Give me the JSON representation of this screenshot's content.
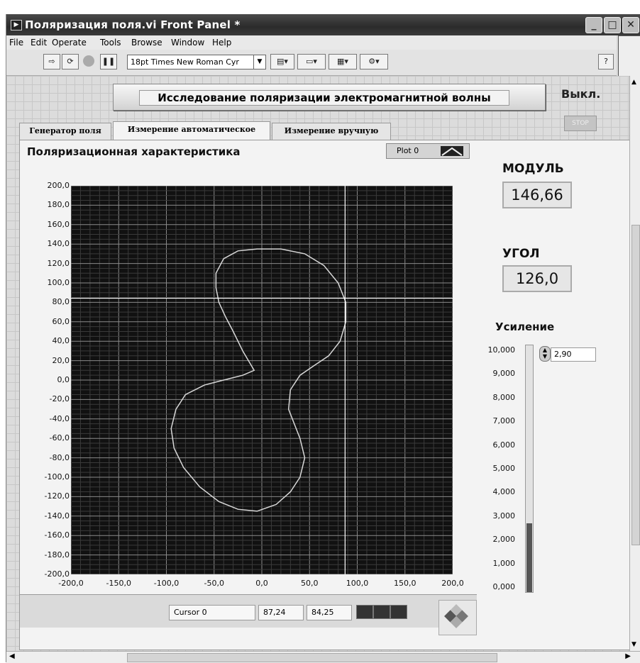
{
  "window": {
    "title": "Поляризация поля.vi Front Panel *"
  },
  "menu": [
    "File",
    "Edit",
    "Operate",
    "Tools",
    "Browse",
    "Window",
    "Help"
  ],
  "toolbar": {
    "font": "18pt Times New Roman Cyr"
  },
  "panel": {
    "title_button": "Исследование поляризации электромагнитной волны",
    "off_label": "Выкл.",
    "stop_label": "STOP",
    "tabs": [
      "Генератор поля",
      "Измерение автоматическое",
      "Измерение вручную"
    ],
    "active_tab_index": 1
  },
  "graph": {
    "title": "Поляризационная характеристика",
    "plot_legend": "Plot 0",
    "cursor": {
      "name": "Cursor 0",
      "x": "87,24",
      "y": "84,25"
    }
  },
  "indicators": {
    "modul_label": "МОДУЛЬ",
    "modul_value": "146,66",
    "angle_label": "УГОЛ",
    "angle_value": "126,0",
    "gain_label": "Усиление",
    "gain_value": "2,90",
    "gain_level": 2.9,
    "gain_ticks": [
      "10,000",
      "9,000",
      "8,000",
      "7,000",
      "6,000",
      "5,000",
      "4,000",
      "3,000",
      "2,000",
      "1,000",
      "0,000"
    ]
  },
  "chart_data": {
    "type": "line",
    "title": "Поляризационная характеристика",
    "xlim": [
      -200,
      200
    ],
    "ylim": [
      -200,
      200
    ],
    "x_ticks": [
      "-200,0",
      "-150,0",
      "-100,0",
      "-50,0",
      "0,0",
      "50,0",
      "100,0",
      "150,0",
      "200,0"
    ],
    "y_ticks": [
      "200,0",
      "180,0",
      "160,0",
      "140,0",
      "120,0",
      "100,0",
      "80,0",
      "60,0",
      "40,0",
      "20,0",
      "0,0",
      "-20,0",
      "-40,0",
      "-60,0",
      "-80,0",
      "-100,0",
      "-120,0",
      "-140,0",
      "-160,0",
      "-180,0",
      "-200,0"
    ],
    "grid": true,
    "cursor": {
      "x": 87.24,
      "y": 84.25
    },
    "series": [
      {
        "x": [
          -8,
          -20,
          -30,
          -38,
          -45,
          -48,
          -48,
          -40,
          -25,
          -5,
          20,
          45,
          65,
          80,
          88,
          88,
          82,
          70,
          55,
          40,
          30,
          28,
          40,
          45,
          40,
          30,
          15,
          -5,
          -25,
          -45,
          -65,
          -82,
          -92,
          -95,
          -90,
          -80,
          -60,
          -40,
          -20,
          -8
        ],
        "y": [
          10,
          30,
          50,
          65,
          80,
          95,
          110,
          125,
          133,
          135,
          135,
          130,
          118,
          100,
          80,
          60,
          40,
          25,
          15,
          5,
          -10,
          -30,
          -60,
          -80,
          -100,
          -115,
          -128,
          -135,
          -133,
          -125,
          -110,
          -90,
          -70,
          -50,
          -30,
          -15,
          -5,
          0,
          5,
          10
        ]
      }
    ]
  }
}
